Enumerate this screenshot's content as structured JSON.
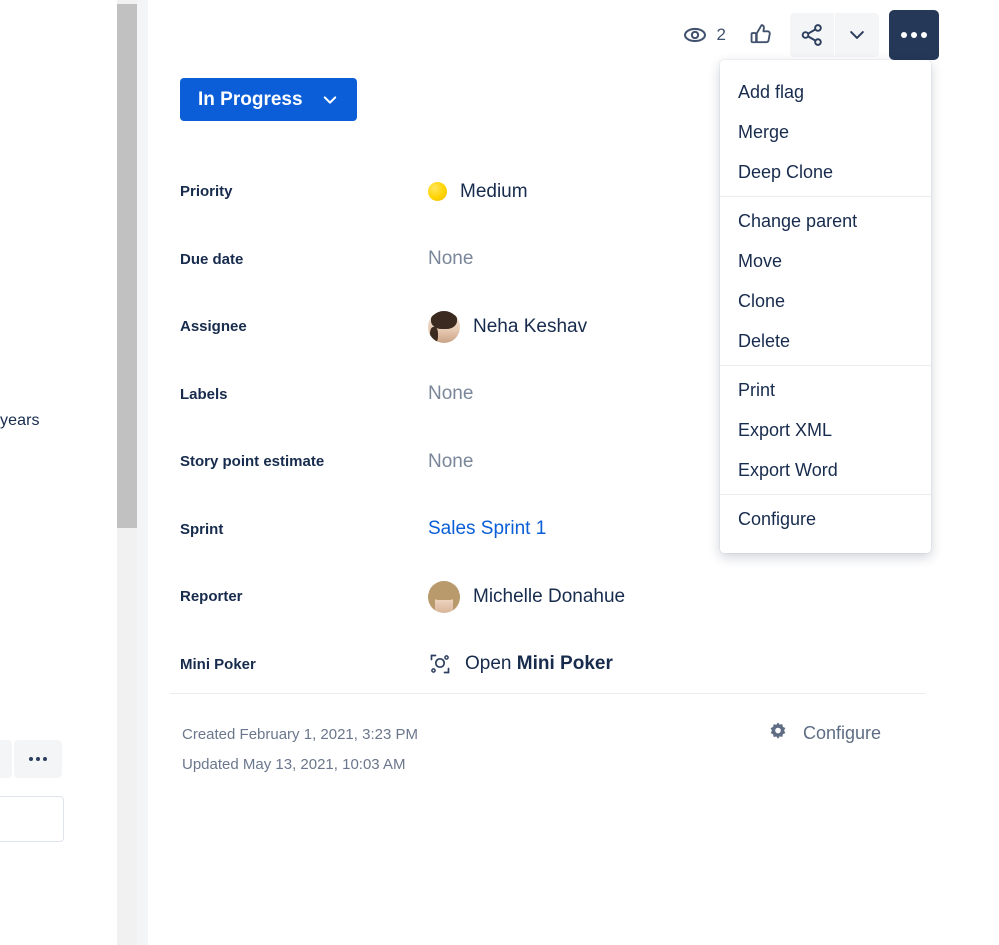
{
  "toolbar": {
    "watch_icon": "eye-icon",
    "watch_count": "2",
    "vote_icon": "thumbs-up-icon",
    "share_icon": "share-icon",
    "chevron_icon": "chevron-down-icon",
    "more_icon": "more-actions-icon"
  },
  "menu": {
    "sections": [
      {
        "items": [
          "Add flag",
          "Merge",
          "Deep Clone"
        ]
      },
      {
        "items": [
          "Change parent",
          "Move",
          "Clone",
          "Delete"
        ]
      },
      {
        "items": [
          "Print",
          "Export XML",
          "Export Word"
        ]
      },
      {
        "items": [
          "Configure"
        ]
      }
    ]
  },
  "status": {
    "label": "In Progress",
    "accent_color": "#0b5ed7",
    "chevron_icon": "chevron-down-icon"
  },
  "fields": [
    {
      "label": "Priority",
      "value": "Medium",
      "kind": "priority",
      "icon": "priority-medium-icon"
    },
    {
      "label": "Due date",
      "value": "None",
      "kind": "none"
    },
    {
      "label": "Assignee",
      "value": "Neha Keshav",
      "kind": "user",
      "icon": "avatar"
    },
    {
      "label": "Labels",
      "value": "None",
      "kind": "none"
    },
    {
      "label": "Story point estimate",
      "value": "None",
      "kind": "none"
    },
    {
      "label": "Sprint",
      "value": "Sales Sprint 1",
      "kind": "link"
    },
    {
      "label": "Reporter",
      "value": "Michelle Donahue",
      "kind": "user",
      "icon": "avatar"
    },
    {
      "label": "Mini Poker",
      "value": "Open ",
      "value_bold": "Mini Poker",
      "kind": "app",
      "icon": "mini-poker-icon"
    }
  ],
  "footer": {
    "created": "Created February 1, 2021, 3:23 PM",
    "updated": "Updated May 13, 2021, 10:03 AM",
    "configure_label": "Configure",
    "configure_icon": "gear-icon"
  },
  "left_column": {
    "fragment_text": "years",
    "more_icon": "more-actions-icon"
  },
  "colors": {
    "accent_blue": "#0b5ed7",
    "dark_navy": "#253858",
    "text": "#172b4d",
    "muted": "#6b778c",
    "page_bg": "#f4f5f7",
    "priority_yellow": "#ffd400"
  }
}
